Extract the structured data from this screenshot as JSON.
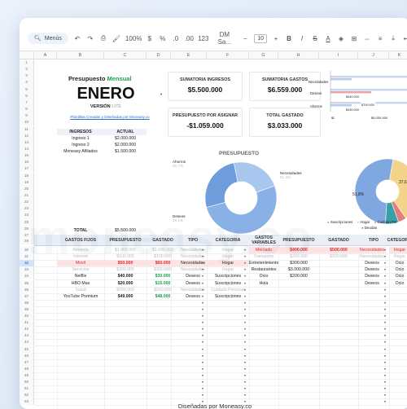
{
  "toolbar": {
    "menus": "Menús",
    "zoom": "100%",
    "currency": "$",
    "percent": "%",
    "decimals": ".0",
    ".00": ".00",
    "numfmt": "123",
    "font": "DM Sa...",
    "fontsize": "10",
    "bold": "B",
    "italic": "I",
    "strike": "S",
    "textcolor": "A"
  },
  "columns": [
    "A",
    "B",
    "C",
    "D",
    "E",
    "F",
    "G",
    "H",
    "I",
    "J",
    "K"
  ],
  "header": {
    "title_part1": "Presupuesto",
    "title_part2": "Mensual",
    "month": "ENERO",
    "version_label": "VERSIÓN",
    "version_value": "LITE",
    "link": "Plantillas Creadas y Diseñadas por Moneasy.co"
  },
  "cards": {
    "ingresos_label": "SUMATORIA INGRESOS",
    "ingresos_value": "$5.500.000",
    "gastos_label": "SUMATORIA GASTOS",
    "gastos_value": "$6.559.000",
    "asignar_label": "PRESUPUESTO POR ASIGNAR",
    "asignar_value": "-$1.059.000",
    "total_label": "TOTAL GASTADO",
    "total_value": "$3.033.000"
  },
  "income": {
    "col_ingresos": "INGRESOS",
    "col_actual": "ACTUAL",
    "rows": [
      {
        "name": "Ingreso 1",
        "value": "$2.000.000"
      },
      {
        "name": "Ingreso 2",
        "value": "$2.000.000"
      },
      {
        "name": "Moneasy Afiliados",
        "value": "$1.500.000"
      }
    ],
    "total_label": "TOTAL",
    "total_value": "$5.500.000"
  },
  "bar_chart": {
    "categories": [
      "Necesidades",
      "Deseos",
      "Ahorros"
    ],
    "labels": [
      "$440.000",
      "$700.000",
      "$430.000"
    ],
    "axis": [
      "$0",
      "$5.000.000",
      "$10.000.000"
    ]
  },
  "donut": {
    "title": "PRESUPUESTO",
    "slices": [
      {
        "name": "Ahorros",
        "pct": "22,7%"
      },
      {
        "name": "Necesidades",
        "pct": "51,3%"
      },
      {
        "name": "Deseos",
        "pct": "26,1%"
      }
    ]
  },
  "pie2": {
    "pct_left": "51,8%",
    "pct_right": "37,6",
    "legend": [
      "Suscripciones",
      "Hogar",
      "Cuidado Per",
      "Deudas"
    ]
  },
  "fixed": {
    "col_gastos": "GASTOS FIJOS",
    "col_presupuesto": "PRESUPUESTO",
    "col_gastado": "GASTADO",
    "col_tipo": "TIPO",
    "col_categoria": "CATEGORIA",
    "rows": [
      {
        "name": "Arriendo",
        "p": "$1.000.000",
        "g": "$1.000.000",
        "tipo": "Necesidades",
        "cat": "Hogar",
        "style": "gray"
      },
      {
        "name": "Internet",
        "p": "$100.000",
        "g": "$100.000",
        "tipo": "Necesidades",
        "cat": "Hogar",
        "style": "gray"
      },
      {
        "name": "Movil",
        "p": "$50.000",
        "g": "$60.000",
        "tipo": "Necesidades",
        "cat": "Hogar",
        "style": "red"
      },
      {
        "name": "Servicios",
        "p": "$300.000",
        "g": "$300.000",
        "tipo": "Necesidades",
        "cat": "Hogar",
        "style": "gray"
      },
      {
        "name": "Netflix",
        "p": "$40.000",
        "g": "$30.000",
        "tipo": "Deseos",
        "cat": "Suscripciones",
        "style": "green"
      },
      {
        "name": "HBO Max",
        "p": "$20.000",
        "g": "$15.000",
        "tipo": "Deseos",
        "cat": "Suscripciones",
        "style": "green"
      },
      {
        "name": "Salud",
        "p": "$200.000",
        "g": "$200.000",
        "tipo": "Necesidades",
        "cat": "Cuidado Personal",
        "style": "gray"
      },
      {
        "name": "YouTube Premium",
        "p": "$49.000",
        "g": "$48.000",
        "tipo": "Deseos",
        "cat": "Suscripciones",
        "style": "green"
      }
    ]
  },
  "variable": {
    "col_gastos": "GASTOS VARIABLES",
    "col_presupuesto": "PRESUPUESTO",
    "col_gastado": "GASTADO",
    "col_tipo": "TIPO",
    "col_categoria": "CATEGORIA",
    "rows": [
      {
        "name": "Mercado",
        "p": "$400.000",
        "g": "$500.000",
        "tipo": "Necesidades",
        "cat": "Hogar",
        "style": "red"
      },
      {
        "name": "Transporte",
        "p": "$200.000",
        "g": "$200.000",
        "tipo": "Necesidades",
        "cat": "Hogar",
        "style": "gray"
      },
      {
        "name": "Entretenimiento",
        "p": "$300.000",
        "g": "",
        "tipo": "Deseos",
        "cat": "Ocio",
        "style": "plain"
      },
      {
        "name": "Restaurantes",
        "p": "$3.000.000",
        "g": "",
        "tipo": "Deseos",
        "cat": "Ocio",
        "style": "plain"
      },
      {
        "name": "Ocio",
        "p": "$200.000",
        "g": "",
        "tipo": "Deseos",
        "cat": "Ocio",
        "style": "plain"
      },
      {
        "name": "Hola",
        "p": "",
        "g": "",
        "tipo": "Deseos",
        "cat": "Ocio",
        "style": "plain"
      }
    ]
  },
  "footer": "Diseñadas por Moneasy.co",
  "watermark": "moneasy.co",
  "colors": {
    "accent_green": "#1aa34a",
    "accent_red": "#d62f2f",
    "header_bg": "#e9eef7"
  }
}
